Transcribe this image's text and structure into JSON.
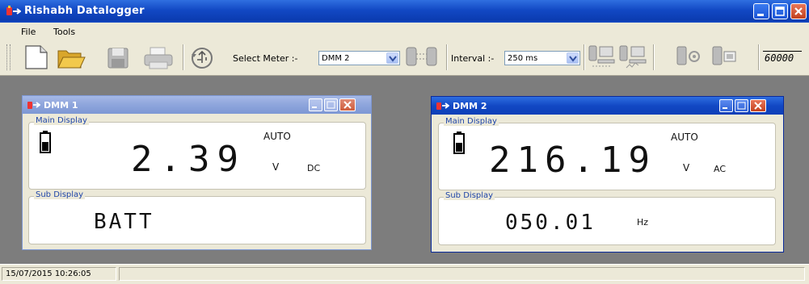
{
  "app": {
    "title": "Rishabh Datalogger"
  },
  "menu": {
    "items": [
      {
        "label": "File"
      },
      {
        "label": "Tools"
      }
    ]
  },
  "toolbar": {
    "select_meter_label": "Select Meter :-",
    "meter_value": "DMM 2",
    "interval_label": "Interval :-",
    "interval_value": "250 ms",
    "counter_display": "60000",
    "icons": [
      "new-file-icon",
      "open-folder-icon",
      "save-disk-icon",
      "print-icon",
      "usb-refresh-icon",
      "meter-link-icon",
      "meter-computer-icon",
      "meter-computer-chart-icon",
      "meter-settings-icon",
      "meter-display-icon"
    ]
  },
  "windows": [
    {
      "title": "DMM 1",
      "main_display_label": "Main Display",
      "range_mode": "AUTO",
      "main_value": "2.39",
      "unit": "V",
      "coupling": "DC",
      "sub_display_label": "Sub Display",
      "sub_value": "BATT",
      "sub_unit": ""
    },
    {
      "title": "DMM 2",
      "main_display_label": "Main Display",
      "range_mode": "AUTO",
      "main_value": "216.19",
      "unit": "V",
      "coupling": "AC",
      "sub_display_label": "Sub Display",
      "sub_value": "050.01",
      "sub_unit": "Hz"
    }
  ],
  "status": {
    "datetime": "15/07/2015 10:26:05"
  },
  "colors": {
    "title_active": "#1248c4",
    "title_inactive": "#8ea5dc",
    "close_red": "#c3411d",
    "panel_bg": "#ece9d8",
    "mdi_bg": "#7d7d7d"
  }
}
